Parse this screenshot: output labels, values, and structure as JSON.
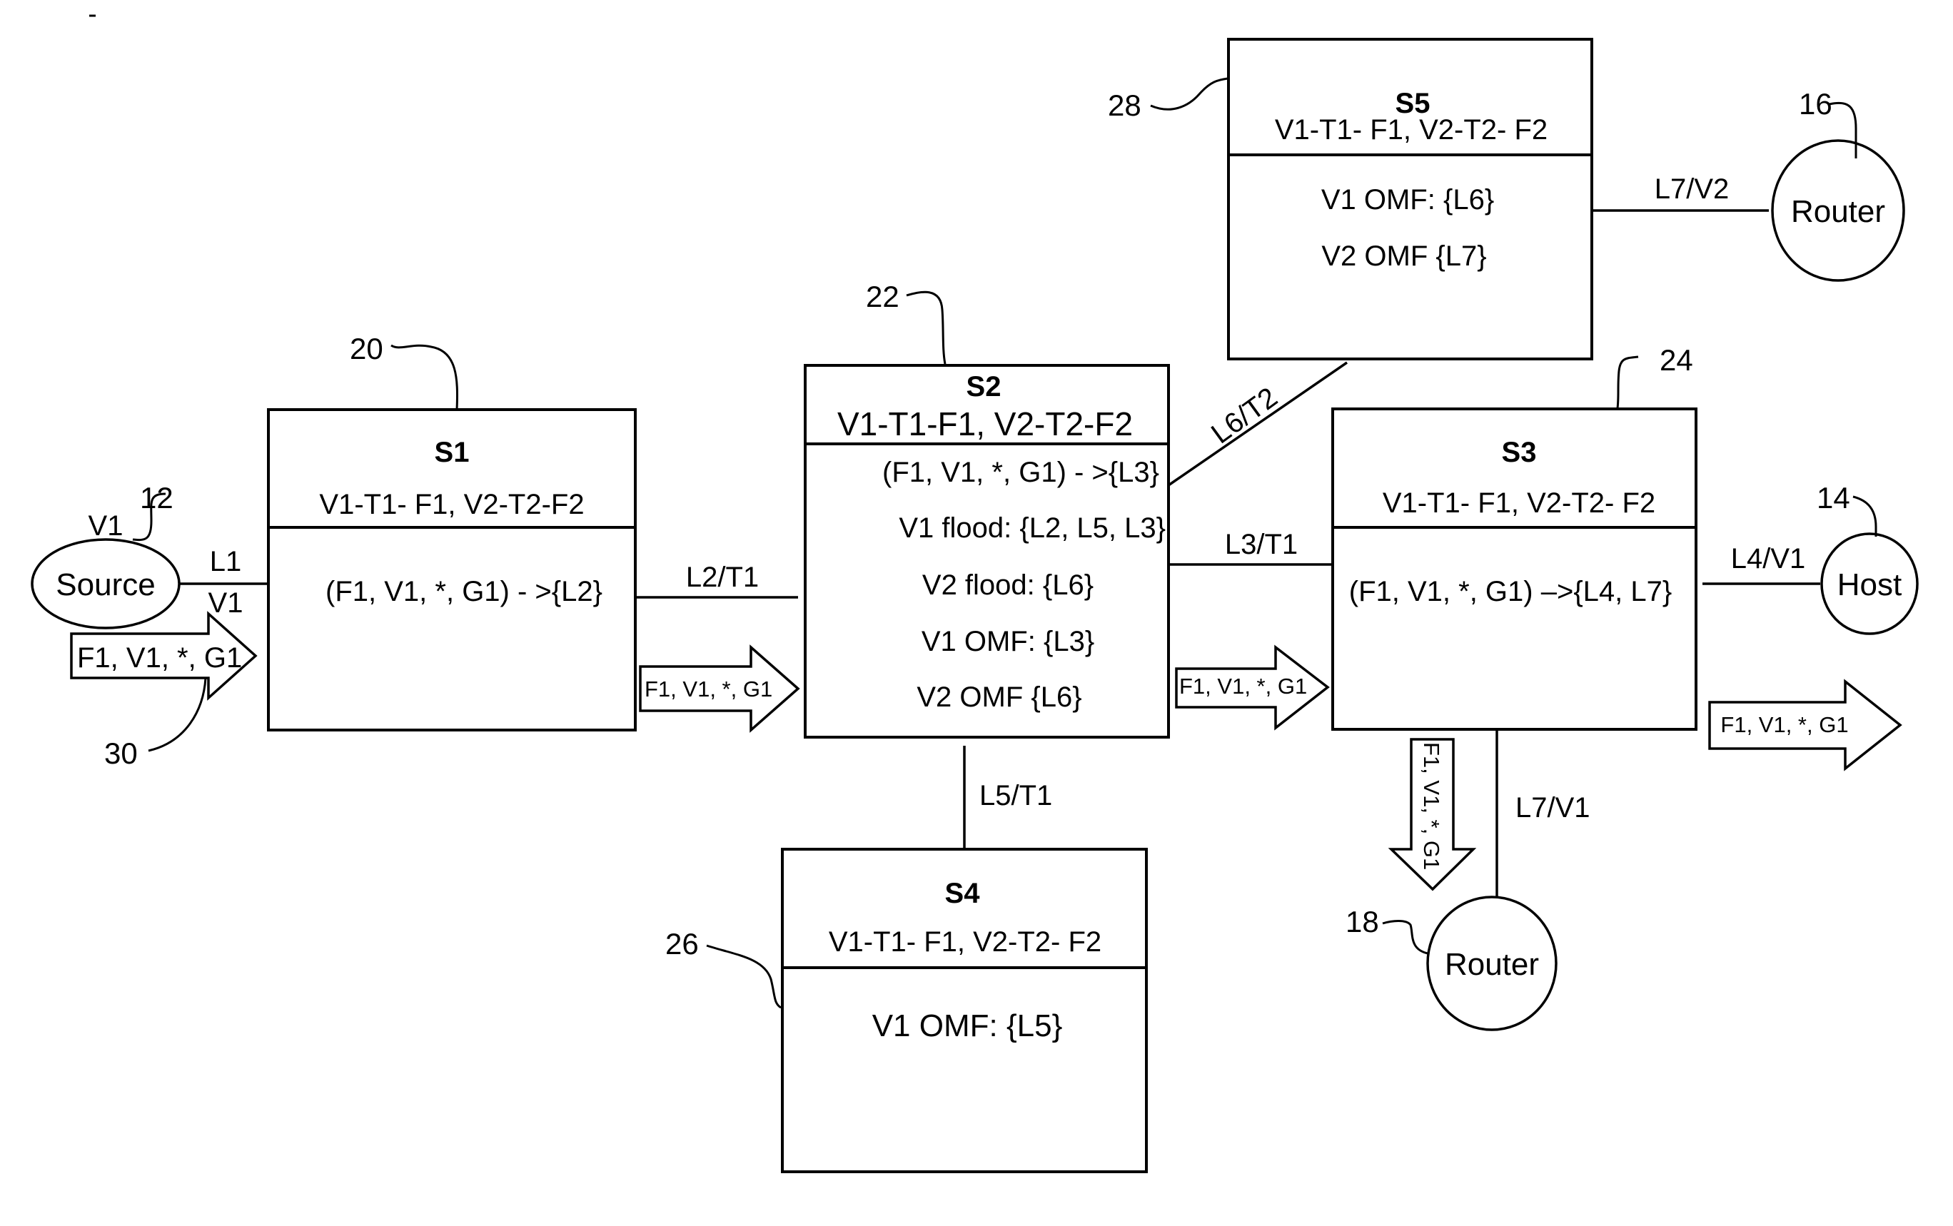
{
  "diagram": {
    "type": "network-topology",
    "switches": [
      {
        "id": "S1",
        "ref": "20",
        "title": "S1",
        "vlan_map": "V1-T1- F1, V2-T2-F2",
        "entries": [
          "(F1, V1, *, G1) - >{L2}"
        ]
      },
      {
        "id": "S2",
        "ref": "22",
        "title": "S2",
        "vlan_map": "V1-T1-F1, V2-T2-F2",
        "entries": [
          "(F1, V1, *, G1) - >{L3}",
          "V1 flood: {L2, L5, L3}",
          "V2 flood: {L6}",
          "V1 OMF: {L3}",
          "V2 OMF {L6}"
        ]
      },
      {
        "id": "S3",
        "ref": "24",
        "title": "S3",
        "vlan_map": "V1-T1- F1, V2-T2- F2",
        "entries": [
          "(F1, V1, *, G1)  –>{L4, L7}"
        ]
      },
      {
        "id": "S4",
        "ref": "26",
        "title": "S4",
        "vlan_map": "V1-T1- F1, V2-T2- F2",
        "entries": [
          "V1 OMF: {L5}"
        ]
      },
      {
        "id": "S5",
        "ref": "28",
        "title": "S5",
        "vlan_map": "V1-T1- F1, V2-T2- F2",
        "entries": [
          "V1 OMF: {L6}",
          "V2 OMF {L7}"
        ]
      }
    ],
    "endpoints": [
      {
        "id": "source",
        "label": "Source",
        "ref": "12",
        "vlan": "V1"
      },
      {
        "id": "host",
        "label": "Host",
        "ref": "14"
      },
      {
        "id": "router16",
        "label": "Router",
        "ref": "16"
      },
      {
        "id": "router18",
        "label": "Router",
        "ref": "18"
      }
    ],
    "links": [
      {
        "id": "L1",
        "label_top": "L1",
        "label_bottom": "V1",
        "from": "source",
        "to": "S1"
      },
      {
        "id": "L2",
        "label": "L2/T1",
        "from": "S1",
        "to": "S2"
      },
      {
        "id": "L3",
        "label": "L3/T1",
        "from": "S2",
        "to": "S3"
      },
      {
        "id": "L4",
        "label": "L4/V1",
        "from": "S3",
        "to": "host"
      },
      {
        "id": "L5",
        "label": "L5/T1",
        "from": "S2",
        "to": "S4"
      },
      {
        "id": "L6",
        "label": "L6/T2",
        "from": "S2",
        "to": "S5"
      },
      {
        "id": "L7a",
        "label": "L7/V2",
        "from": "S5",
        "to": "router16"
      },
      {
        "id": "L7b",
        "label": "L7/V1",
        "from": "S3",
        "to": "router18"
      }
    ],
    "packet": {
      "label": "F1, V1, *, G1",
      "ref": "30"
    }
  }
}
